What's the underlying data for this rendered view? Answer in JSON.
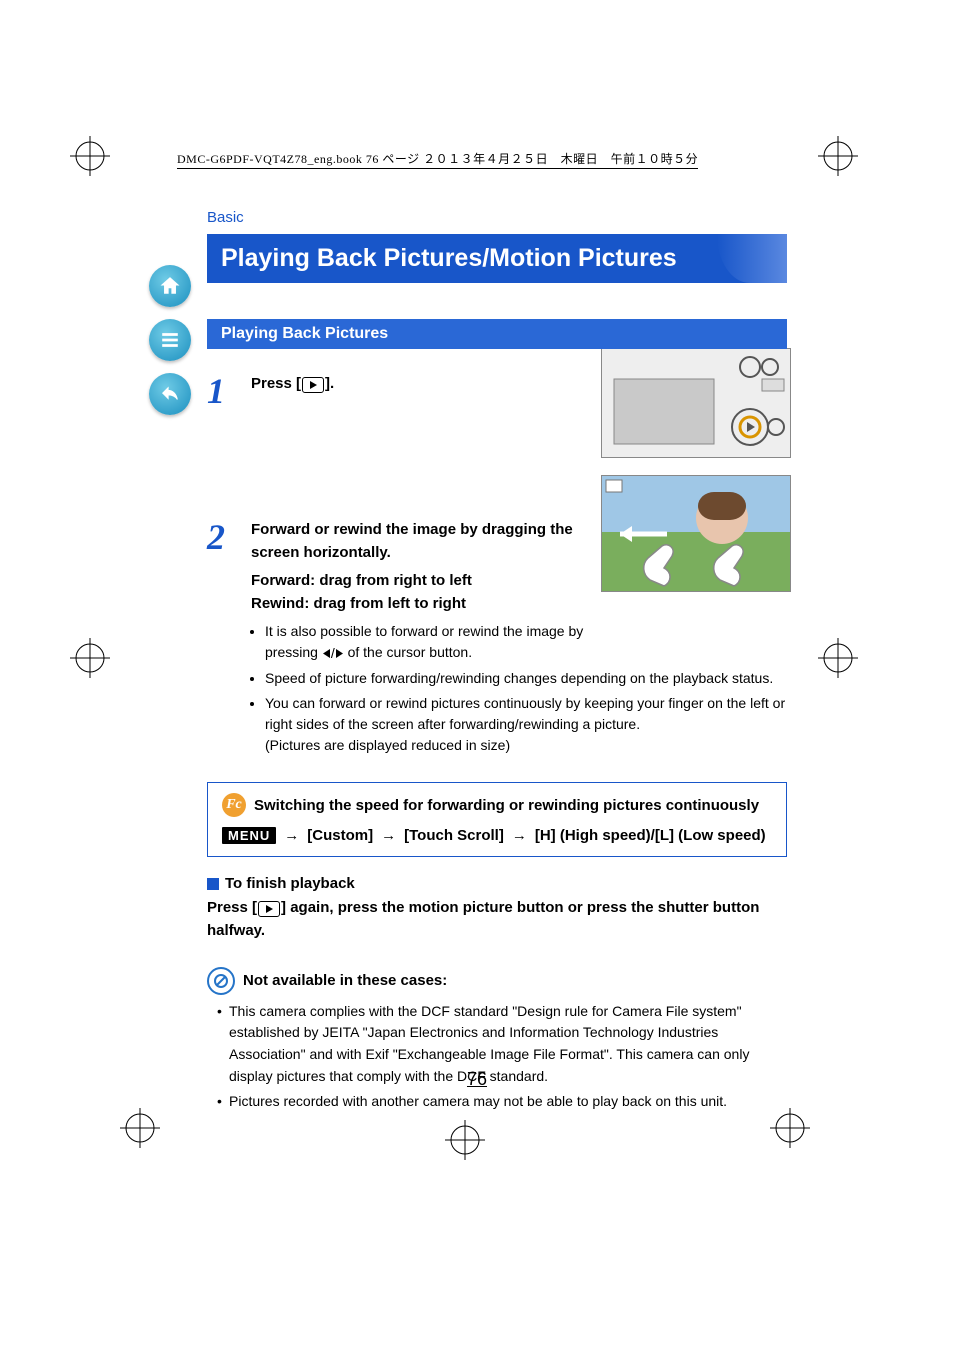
{
  "header_line": "DMC-G6PDF-VQT4Z78_eng.book  76 ページ  ２０１３年４月２５日　木曜日　午前１０時５分",
  "breadcrumb": "Basic",
  "page_title": "Playing Back Pictures/Motion Pictures",
  "section_header": "Playing Back Pictures",
  "step1": {
    "num": "1",
    "text_before": "Press [",
    "text_after": "]."
  },
  "step2": {
    "num": "2",
    "title": "Forward or rewind the image by dragging the screen horizontally.",
    "sub1": "Forward: drag from right to left",
    "sub2": "Rewind: drag from left to right",
    "bullet1a": "It is also possible to forward or rewind the image by pressing ",
    "bullet1b": " of the cursor button.",
    "bullet2": "Speed of picture forwarding/rewinding changes depending on the playback status.",
    "bullet3": "You can forward or rewind pictures continuously by keeping your finger on the left or right sides of the screen after forwarding/rewinding a picture.",
    "bullet3_paren": "(Pictures are displayed reduced in size)"
  },
  "panel": {
    "badge": "Fc",
    "heading": "Switching the speed for forwarding or rewinding pictures continuously",
    "menu_label": "MENU",
    "path1": "[Custom]",
    "path2": "[Touch Scroll]",
    "path3": "[H] (High speed)/[L] (Low speed)"
  },
  "finish": {
    "heading": "To finish playback",
    "body_before": "Press [",
    "body_after": "] again, press the motion picture button or press the shutter button halfway."
  },
  "not_available": {
    "heading": "Not available in these cases:",
    "fn1": "This camera complies with the DCF standard \"Design rule for Camera File system\" established by JEITA \"Japan Electronics and Information Technology Industries Association\" and with Exif \"Exchangeable Image File Format\". This camera can only display pictures that comply with the DCF standard.",
    "fn2": "Pictures recorded with another camera may not be able to play back on this unit."
  },
  "page_number": "76"
}
